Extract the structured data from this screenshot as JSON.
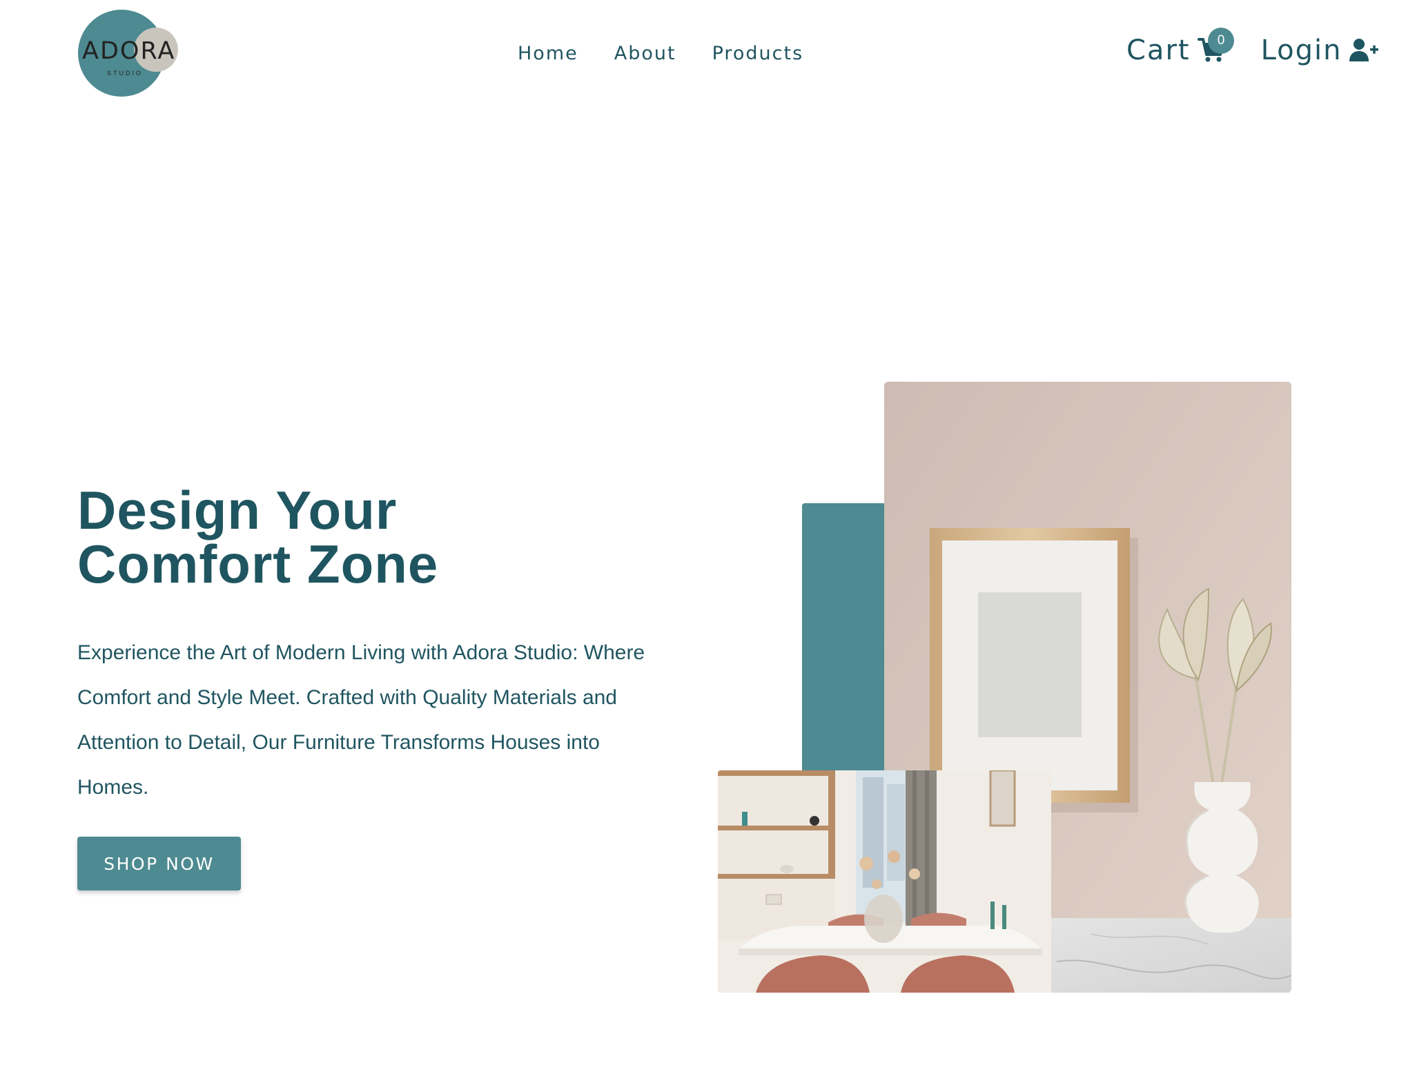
{
  "brand": {
    "name": "ADORA",
    "tagline": "STUDIO",
    "colors": {
      "primary": "#4e8a91",
      "text": "#1f5560",
      "secondary": "#c9c5bd"
    }
  },
  "nav": {
    "items": [
      {
        "label": "Home"
      },
      {
        "label": "About"
      },
      {
        "label": "Products"
      }
    ]
  },
  "header": {
    "cart_label": "Cart",
    "cart_icon": "shopping-cart-icon",
    "cart_count": "0",
    "login_label": "Login",
    "login_icon": "user-plus-icon"
  },
  "hero": {
    "title_line1": "Design Your",
    "title_line2": "Comfort Zone",
    "description": "Experience the Art of Modern Living with Adora Studio: Where Comfort and Style Meet. Crafted with Quality Materials and Attention to Detail, Our Furniture Transforms Houses into Homes.",
    "cta_label": "SHOP NOW"
  }
}
